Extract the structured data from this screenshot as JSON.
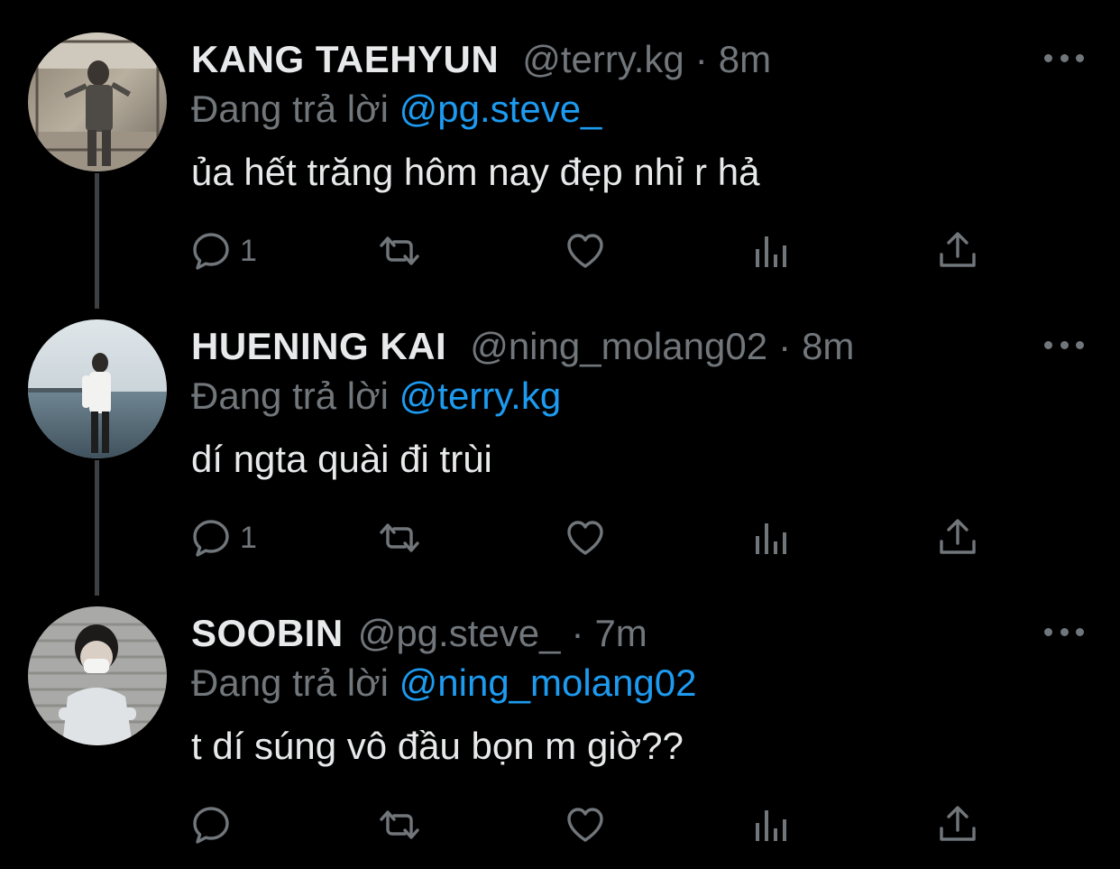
{
  "colors": {
    "background": "#000000",
    "text_primary": "#e7e9ea",
    "text_secondary": "#71767b",
    "accent": "#1d9bf0",
    "thread_line": "#3e4144"
  },
  "icons": {
    "reply": "speech-bubble-icon",
    "retweet": "retweet-arrows-icon",
    "like": "heart-icon",
    "views": "bar-chart-icon",
    "share": "upload-share-icon",
    "more": "three-dots-icon"
  },
  "tweets": [
    {
      "display_name": "KANG TAEHYUN",
      "handle": "@terry.kg",
      "separator": "·",
      "time": "8m",
      "reply_prefix": "Đang trả lời",
      "reply_to": "@pg.steve_",
      "text": "ủa hết trăng hôm nay đẹp nhỉ r hả",
      "reply_count": "1"
    },
    {
      "display_name": "HUENING KAI",
      "handle": "@ning_molang02",
      "separator": "·",
      "time": "8m",
      "reply_prefix": "Đang trả lời",
      "reply_to": "@terry.kg",
      "text": "dí ngta quài đi trùi",
      "reply_count": "1"
    },
    {
      "display_name": "SOOBIN",
      "handle": "@pg.steve_",
      "separator": "·",
      "time": "7m",
      "reply_prefix": "Đang trả lời",
      "reply_to": "@ning_molang02",
      "text": "t dí súng vô đầu bọn m giờ??",
      "reply_count": ""
    }
  ]
}
